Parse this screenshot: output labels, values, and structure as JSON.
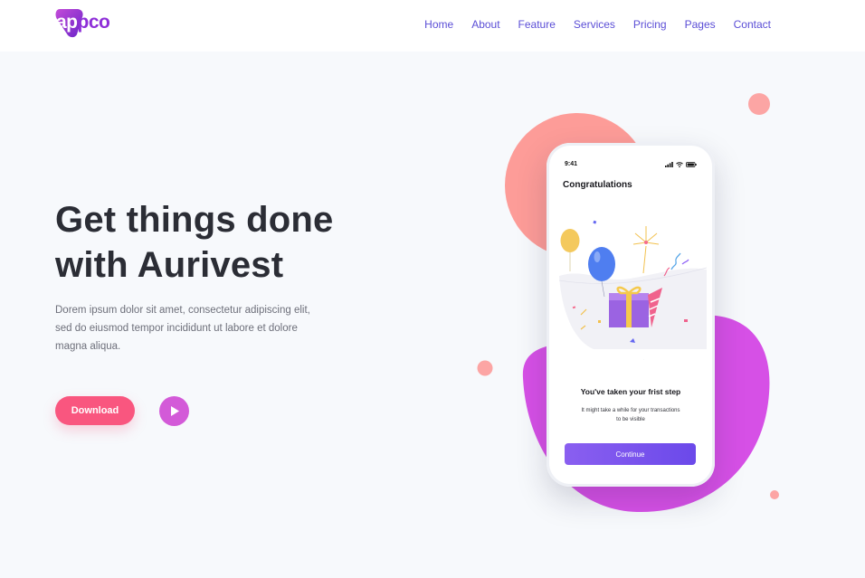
{
  "brand": {
    "logo_part1": "ap",
    "logo_part2": "pco"
  },
  "nav": {
    "items": [
      "Home",
      "About",
      "Feature",
      "Services",
      "Pricing",
      "Pages",
      "Contact"
    ]
  },
  "hero": {
    "title_line1": "Get things done",
    "title_line2": "with Aurivest",
    "description_line1": "Dorem ipsum dolor sit amet, consectetur adipiscing elit,",
    "description_line2": "sed do eiusmod tempor incididunt ut labore et dolore",
    "description_line3": "magna aliqua.",
    "download_label": "Download"
  },
  "phone": {
    "time": "9:41",
    "screen_title": "Congratulations",
    "step_title": "You've taken your frist step",
    "step_subtitle_line1": "It might take a while for your transactions",
    "step_subtitle_line2": "to be visible",
    "continue_label": "Continue"
  },
  "colors": {
    "accent_pink": "#f9567f",
    "accent_purple": "#d35ad8",
    "nav_text": "#5b4ed6",
    "continue_button": "#7b55ee"
  },
  "icons": {
    "play": "play-icon",
    "logo": "logo-badge-icon"
  }
}
